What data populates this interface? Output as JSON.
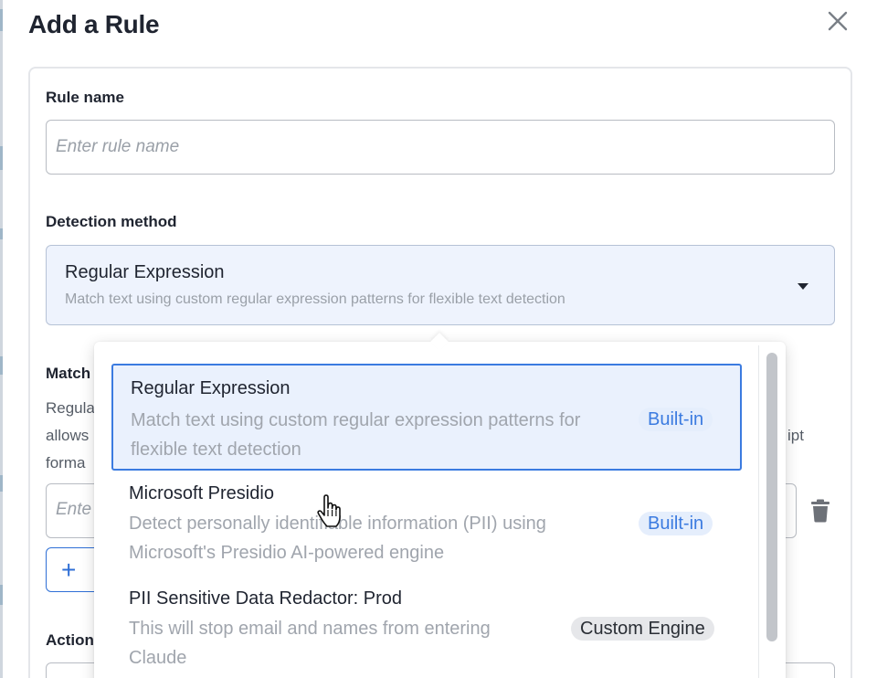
{
  "dialog": {
    "title": "Add a Rule"
  },
  "form": {
    "rule_name_label": "Rule name",
    "rule_name_placeholder": "Enter rule name",
    "detection_method_label": "Detection method",
    "selected_method": {
      "title": "Regular Expression",
      "description": "Match text using custom regular expression patterns for flexible text detection"
    },
    "behind": {
      "section_label": "Match",
      "line1": "Regula",
      "line2": "allows",
      "line3": "forma",
      "line_tail": "ipt",
      "input_placeholder": "Ente",
      "add_button_fragment": "+",
      "actions_label": "Action"
    }
  },
  "dropdown": {
    "options": [
      {
        "title": "Regular Expression",
        "description": "Match text using custom regular expression patterns for flexible text detection",
        "badge": "Built-in",
        "selected": true
      },
      {
        "title": "Microsoft Presidio",
        "description": "Detect personally identifiable information (PII) using Microsoft's Presidio AI-powered engine",
        "badge": "Built-in",
        "selected": false
      },
      {
        "title": "PII Sensitive Data Redactor: Prod",
        "description": "This will stop email and names from entering Claude",
        "badge": "Custom Engine",
        "selected": false
      }
    ]
  },
  "icons": {
    "close": "close-icon",
    "caret": "chevron-down-icon",
    "trash": "trash-icon",
    "cursor": "hand-pointer-cursor"
  },
  "colors": {
    "accent": "#3b7be0",
    "selected_bg": "#eaf1fd",
    "badge_builtin_bg": "#e5eefc",
    "badge_custom_bg": "#e6e7ea"
  }
}
